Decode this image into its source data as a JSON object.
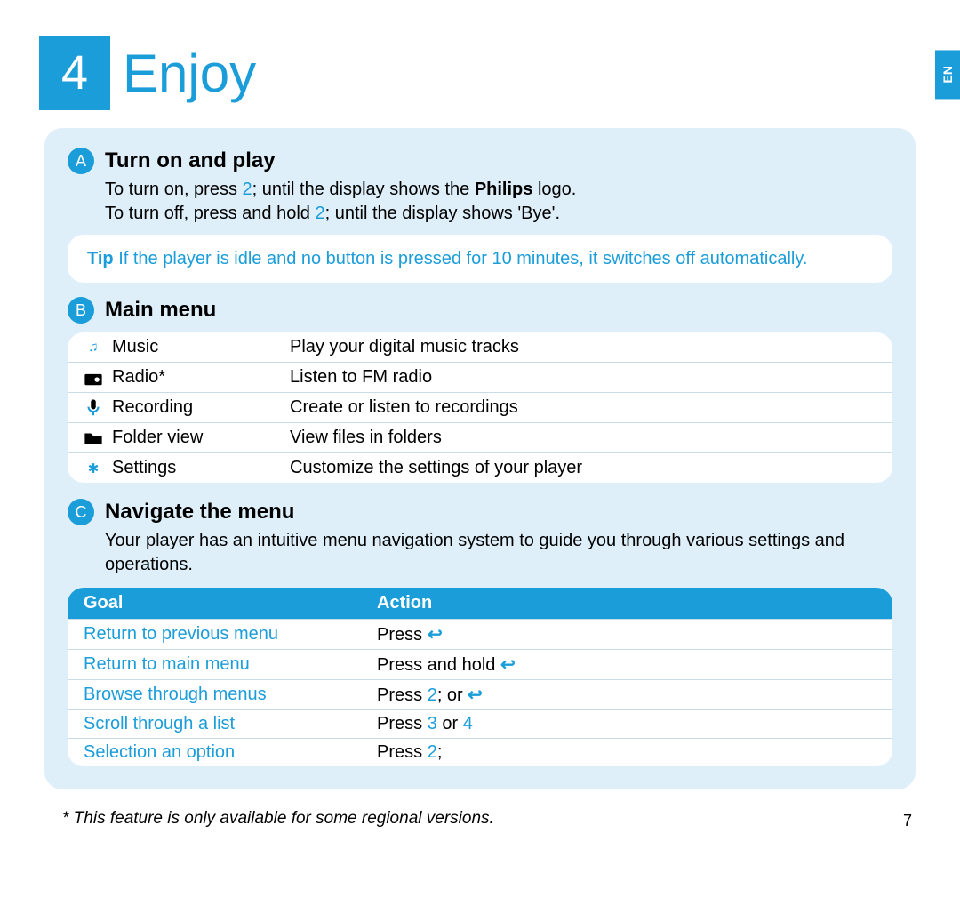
{
  "chapter": {
    "number": "4",
    "title": "Enjoy"
  },
  "lang_tab": "EN",
  "section_a": {
    "letter": "A",
    "title": "Turn on and play",
    "line1a": "To turn on, press ",
    "line1_num": "2",
    "line1_semi": ";",
    "line1b": "  until the display shows the ",
    "line1_bold": "Philips",
    "line1c": " logo.",
    "line2a": "To turn off, press and hold ",
    "line2_num": "2",
    "line2_semi": ";",
    "line2b": "  until the display shows 'Bye'.",
    "tip_label": "Tip",
    "tip_text": " If the player is idle and no button is pressed for 10 minutes, it switches off automatically."
  },
  "section_b": {
    "letter": "B",
    "title": "Main menu",
    "rows": [
      {
        "icon": "music",
        "name": "Music",
        "desc": "Play your digital music tracks"
      },
      {
        "icon": "radio",
        "name": "Radio*",
        "desc": "Listen to FM radio"
      },
      {
        "icon": "mic",
        "name": "Recording",
        "desc": "Create or listen to recordings"
      },
      {
        "icon": "folder",
        "name": "Folder view",
        "desc": "View files in folders"
      },
      {
        "icon": "gear",
        "name": "Settings",
        "desc": "Customize the settings of your player"
      }
    ]
  },
  "section_c": {
    "letter": "C",
    "title": "Navigate the menu",
    "intro": "Your player has an intuitive menu navigation system to guide you through various settings and operations.",
    "head_goal": "Goal",
    "head_action": "Action",
    "rows": [
      {
        "goal": "Return to previous menu",
        "pre": "Press ",
        "numA": "",
        "mid": "",
        "ret": true,
        "post": ""
      },
      {
        "goal": "Return to main menu",
        "pre": "Press and hold ",
        "numA": "",
        "mid": "",
        "ret": true,
        "post": ""
      },
      {
        "goal": "Browse through menus",
        "pre": "Press ",
        "numA": "2",
        "semi": ";",
        "mid": "  or ",
        "ret": true,
        "post": ""
      },
      {
        "goal": "Scroll through a list",
        "pre": "Press ",
        "numA": "3",
        "mid": " or ",
        "numB": "4",
        "ret": false,
        "post": ""
      },
      {
        "goal": "Selection an option",
        "pre": "Press ",
        "numA": "2",
        "semi": ";",
        "mid": "",
        "ret": false,
        "post": ""
      }
    ]
  },
  "footnote": "*  This feature is only available for some regional versions.",
  "page_number": "7"
}
